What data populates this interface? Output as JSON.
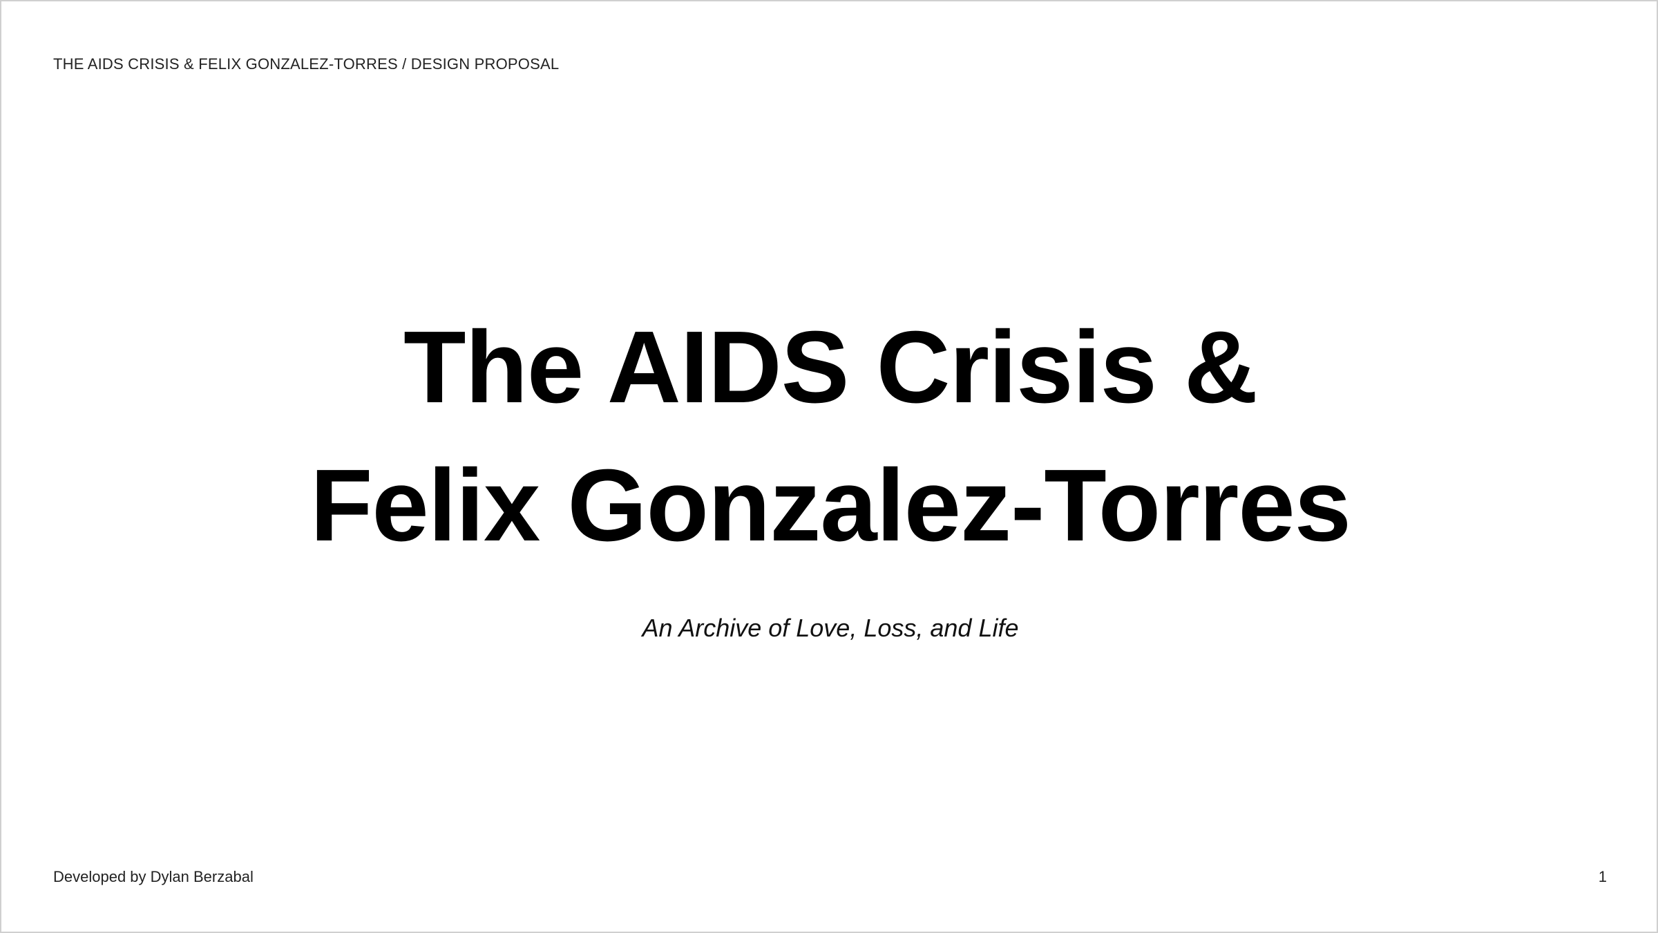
{
  "slide": {
    "header": "THE AIDS CRISIS & FELIX GONZALEZ-TORRES / DESIGN PROPOSAL",
    "title_lines": [
      "The AIDS Crisis &",
      "Felix Gonzalez-Torres"
    ],
    "subtitle": "An Archive of Love, Loss, and Life",
    "footer_credit": "Developed by Dylan Berzabal",
    "page_number": "1"
  }
}
